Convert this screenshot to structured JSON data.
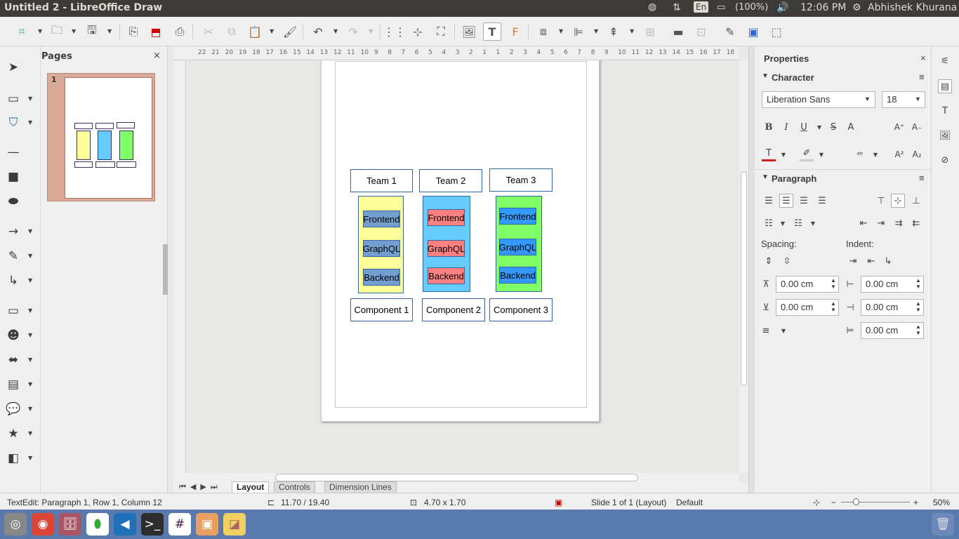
{
  "window": {
    "title": "Untitled 2 - LibreOffice Draw"
  },
  "tray": {
    "keyboard": "En",
    "battery": "(100%)",
    "time": "12:06 PM",
    "user": "Abhishek Khurana"
  },
  "pages_panel": {
    "title": "Pages",
    "page_number": "1"
  },
  "ruler": {
    "h_labels": [
      "22",
      "21",
      "20",
      "19",
      "18",
      "17",
      "16",
      "15",
      "14",
      "13",
      "12",
      "11",
      "10",
      "9",
      "8",
      "7",
      "6",
      "5",
      "4",
      "3",
      "2",
      "1",
      "1",
      "2",
      "3",
      "4",
      "5",
      "6",
      "7",
      "8",
      "9",
      "10",
      "11",
      "12",
      "13",
      "14",
      "15",
      "16",
      "17",
      "18"
    ]
  },
  "drawing": {
    "teams": [
      "Team 1",
      "Team 2",
      "Team 3"
    ],
    "components": [
      "Component 1",
      "Component 2",
      "Component 3"
    ],
    "layers": [
      "Frontend",
      "GraphQL",
      "Backend"
    ],
    "colors": {
      "col1": "#ffff99",
      "col2": "#66ccff",
      "col3": "#80ff66",
      "box1": "#729fcf",
      "box2": "#ff8080",
      "box3": "#3399ff",
      "border": "#3465a4"
    }
  },
  "properties": {
    "title": "Properties",
    "character": {
      "title": "Character",
      "font": "Liberation Sans",
      "size": "18"
    },
    "paragraph": {
      "title": "Paragraph",
      "spacing_label": "Spacing:",
      "indent_label": "Indent:",
      "above": "0.00 cm",
      "below": "0.00 cm",
      "before": "0.00 cm",
      "after": "0.00 cm",
      "first_line": "0.00 cm"
    }
  },
  "tabs": [
    "Layout",
    "Controls",
    "Dimension Lines"
  ],
  "status": {
    "text_edit": "TextEdit: Paragraph 1, Row 1, Column 12",
    "position": "11.70 / 19.40",
    "size": "4.70 x 1.70",
    "slide": "Slide 1 of 1 (Layout)",
    "layout": "Default",
    "zoom": "50%"
  }
}
